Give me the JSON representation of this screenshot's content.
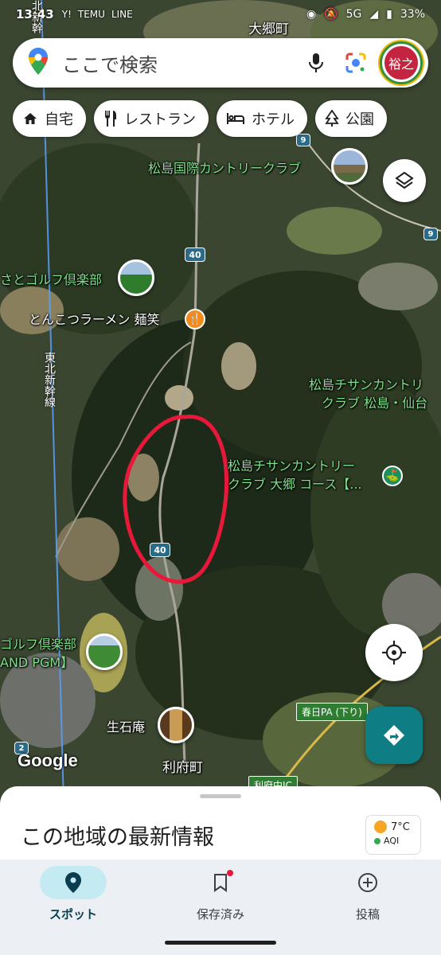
{
  "status_bar": {
    "time": "13:43",
    "notifications": [
      "Y!",
      "TEMU",
      "LINE"
    ],
    "network": "5G",
    "battery": "33%"
  },
  "search": {
    "placeholder": "ここで検索",
    "avatar_text": "裕之"
  },
  "chips": [
    {
      "label": "自宅",
      "icon": "home-icon"
    },
    {
      "label": "レストラン",
      "icon": "restaurant-icon"
    },
    {
      "label": "ホテル",
      "icon": "hotel-icon"
    },
    {
      "label": "公園",
      "icon": "tree-icon"
    }
  ],
  "map": {
    "labels": {
      "town_top": "大郷町",
      "golf_matsushima": "松島国際カントリークラブ",
      "golf_left_partial": "さとゴルフ倶楽部",
      "ramen": "とんこつラーメン 麺笑",
      "rail_line": "東北新幹線",
      "rail_line_top": "北新幹",
      "chisan_1_line1": "松島チサンカントリ",
      "chisan_1_line2": "クラブ 松島・仙台",
      "chisan_2_line1": "松島チサンカントリー",
      "chisan_2_line2": "クラブ 大郷 コース【...",
      "golf_left_bottom_line1": "ゴルフ倶楽部",
      "golf_left_bottom_line2": "AND PGM】",
      "ikoishian": "生石庵",
      "rifu_town": "利府町",
      "kasuga_pa": "春日PA (下り)",
      "rifu_ic": "利府中IC",
      "google": "Google"
    },
    "route_shields": [
      "40",
      "40",
      "40",
      "9",
      "9",
      "2"
    ],
    "annotation": "red hand-drawn circle around route 40"
  },
  "bottom_sheet": {
    "title": "この地域の最新情報",
    "weather_temp": "7°C",
    "weather_aqi": "AQI"
  },
  "bottom_nav": [
    {
      "label": "スポット",
      "icon": "location-pin-icon",
      "active": true
    },
    {
      "label": "保存済み",
      "icon": "bookmark-icon",
      "active": false
    },
    {
      "label": "投稿",
      "icon": "add-circle-icon",
      "active": false
    }
  ],
  "colors": {
    "accent": "#0f7d84",
    "nav_active_bg": "#c4ebf2",
    "map_label_green": "#7fe08a",
    "annotation_red": "#e8183a"
  }
}
